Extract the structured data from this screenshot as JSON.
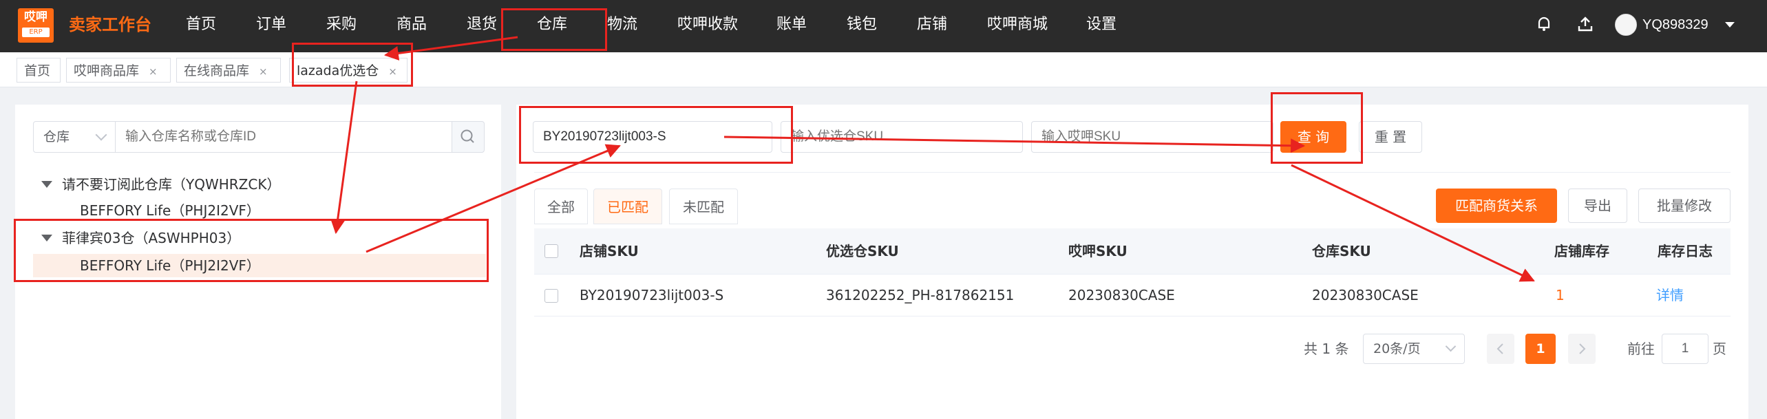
{
  "header": {
    "logo_top": "哎呷",
    "logo_bottom": "ERP",
    "brand": "卖家工作台",
    "nav": [
      "首页",
      "订单",
      "采购",
      "商品",
      "退货",
      "仓库",
      "物流",
      "哎呷收款",
      "账单",
      "钱包",
      "店铺",
      "哎呷商城",
      "设置"
    ],
    "username": "YQ898329"
  },
  "tabs": [
    {
      "label": "首页",
      "closable": false
    },
    {
      "label": "哎呷商品库",
      "closable": true
    },
    {
      "label": "在线商品库",
      "closable": true
    },
    {
      "label": "lazada优选仓",
      "closable": true
    }
  ],
  "tab_close_glyph": "×",
  "left": {
    "select_value": "仓库",
    "search_placeholder": "输入仓库名称或仓库ID",
    "tree": [
      {
        "label": "请不要订阅此仓库（YQWHRZCK）",
        "child": "BEFFORY Life（PHJ2I2VF）"
      },
      {
        "label": "菲律宾03仓（ASWHPH03）",
        "child": "BEFFORY Life（PHJ2I2VF）"
      }
    ]
  },
  "filters": {
    "sku_value": "BY20190723lijt003-S",
    "optimal_placeholder": "输入优选仓SKU",
    "yiya_placeholder": "输入哎呷SKU",
    "query_label": "查 询",
    "reset_label": "重 置"
  },
  "match_tabs": [
    "全部",
    "已匹配",
    "未匹配"
  ],
  "actions": {
    "match_label": "匹配商货关系",
    "export_label": "导出",
    "batch_label": "批量修改"
  },
  "table": {
    "headers": [
      "店铺SKU",
      "优选仓SKU",
      "哎呷SKU",
      "仓库SKU",
      "店铺库存",
      "库存日志"
    ],
    "rows": [
      {
        "shop_sku": "BY20190723lijt003-S",
        "optimal_sku": "361202252_PH-817862151",
        "yiya_sku": "20230830CASE",
        "warehouse_sku": "20230830CASE",
        "stock": "1",
        "log": "详情"
      }
    ]
  },
  "pagination": {
    "total_text": "共 1 条",
    "page_size": "20条/页",
    "current_page": "1",
    "goto_label": "前往",
    "goto_value": "1",
    "page_suffix": "页"
  },
  "colors": {
    "accent": "#ff6a14",
    "annotation": "#e8231f",
    "link": "#409eff",
    "topbar": "#2b2b2b"
  }
}
